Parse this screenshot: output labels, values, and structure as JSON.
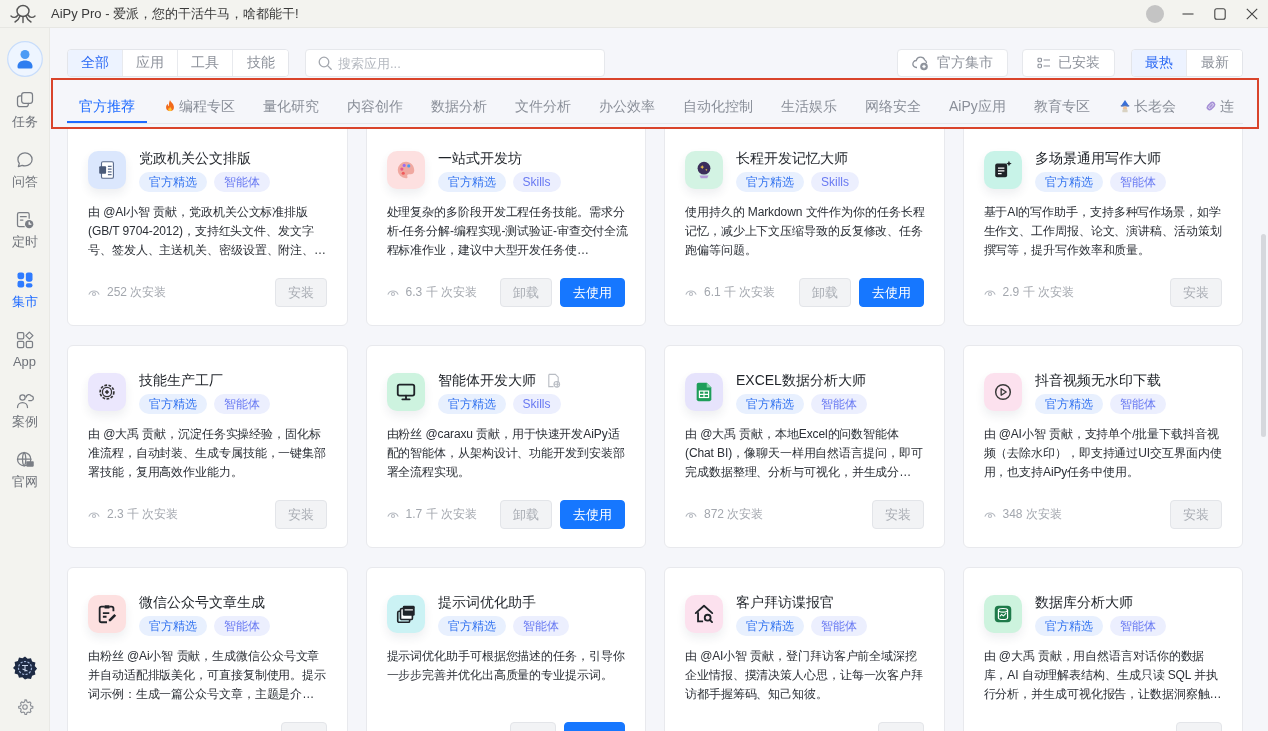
{
  "window": {
    "title": "AiPy Pro - 爱派，您的干活牛马，啥都能干!"
  },
  "sidebar": {
    "items": [
      {
        "label": "任务",
        "selected": false
      },
      {
        "label": "问答",
        "selected": false
      },
      {
        "label": "定时",
        "selected": false
      },
      {
        "label": "集市",
        "selected": true
      },
      {
        "label": "App",
        "selected": false
      },
      {
        "label": "案例",
        "selected": false
      },
      {
        "label": "官网",
        "selected": false
      }
    ]
  },
  "filter_tabs": [
    {
      "label": "全部",
      "selected": true
    },
    {
      "label": "应用",
      "selected": false
    },
    {
      "label": "工具",
      "selected": false
    },
    {
      "label": "技能",
      "selected": false
    }
  ],
  "search": {
    "placeholder": "搜索应用..."
  },
  "toolbar_buttons": [
    {
      "label": "官方集市"
    },
    {
      "label": "已安装"
    }
  ],
  "sort_tabs": [
    {
      "label": "最热",
      "selected": true
    },
    {
      "label": "最新",
      "selected": false
    }
  ],
  "category_tabs": [
    {
      "label": "官方推荐",
      "selected": true
    },
    {
      "label": "编程专区",
      "selected": false
    },
    {
      "label": "量化研究",
      "selected": false
    },
    {
      "label": "内容创作",
      "selected": false
    },
    {
      "label": "数据分析",
      "selected": false
    },
    {
      "label": "文件分析",
      "selected": false
    },
    {
      "label": "办公效率",
      "selected": false
    },
    {
      "label": "自动化控制",
      "selected": false
    },
    {
      "label": "生活娱乐",
      "selected": false
    },
    {
      "label": "网络安全",
      "selected": false
    },
    {
      "label": "AiPy应用",
      "selected": false
    },
    {
      "label": "教育专区",
      "selected": false
    },
    {
      "label": "长老会",
      "selected": false
    },
    {
      "label": "连",
      "selected": false
    }
  ],
  "cards": [
    {
      "title": "党政机关公文排版",
      "color": "#dbe7fd",
      "tags": [
        {
          "label": "官方精选",
          "kind": "featured"
        },
        {
          "label": "智能体",
          "kind": "type"
        }
      ],
      "description": "由 @AI小智 贡献，党政机关公文标准排版(GB/T 9704-2012)，支持红头文件、发文字号、签发人、主送机关、密级设置、附注、…",
      "installs": "252 次安装",
      "actions": [
        {
          "label": "安装",
          "kind": "secondary"
        }
      ]
    },
    {
      "title": "一站式开发坊",
      "color": "#fde0e0",
      "tags": [
        {
          "label": "官方精选",
          "kind": "featured"
        },
        {
          "label": "Skills",
          "kind": "type"
        }
      ],
      "description": "处理复杂的多阶段开发工程任务技能。需求分析-任务分解-编程实现-测试验证-审查交付全流程标准作业，建议中大型开发任务使…",
      "installs": "6.3 千 次安装",
      "actions": [
        {
          "label": "卸载",
          "kind": "secondary"
        },
        {
          "label": "去使用",
          "kind": "primary"
        }
      ]
    },
    {
      "title": "长程开发记忆大师",
      "color": "#d3f3e3",
      "tags": [
        {
          "label": "官方精选",
          "kind": "featured"
        },
        {
          "label": "Skills",
          "kind": "type"
        }
      ],
      "description": "使用持久的 Markdown 文件作为你的任务长程记忆，减少上下文压缩导致的反复修改、任务跑偏等问题。",
      "installs": "6.1 千 次安装",
      "actions": [
        {
          "label": "卸载",
          "kind": "secondary"
        },
        {
          "label": "去使用",
          "kind": "primary"
        }
      ]
    },
    {
      "title": "多场景通用写作大师",
      "color": "#c8f3e8",
      "tags": [
        {
          "label": "官方精选",
          "kind": "featured"
        },
        {
          "label": "智能体",
          "kind": "type"
        }
      ],
      "description": "基于AI的写作助手，支持多种写作场景，如学生作文、工作周报、论文、演讲稿、活动策划撰写等，提升写作效率和质量。",
      "installs": "2.9 千 次安装",
      "actions": [
        {
          "label": "安装",
          "kind": "secondary"
        }
      ]
    },
    {
      "title": "技能生产工厂",
      "color": "#ebe7fd",
      "tags": [
        {
          "label": "官方精选",
          "kind": "featured"
        },
        {
          "label": "智能体",
          "kind": "type"
        }
      ],
      "description": "由 @大禹 贡献，沉淀任务实操经验，固化标准流程，自动封装、生成专属技能，一键集部署技能，复用高效作业能力。",
      "installs": "2.3 千 次安装",
      "actions": [
        {
          "label": "安装",
          "kind": "secondary"
        }
      ]
    },
    {
      "title": "智能体开发大师",
      "color": "#cdf3df",
      "title_badge": true,
      "tags": [
        {
          "label": "官方精选",
          "kind": "featured"
        },
        {
          "label": "Skills",
          "kind": "type"
        }
      ],
      "description": "由粉丝 @caraxu 贡献，用于快速开发AiPy适配的智能体，从架构设计、功能开发到安装部署全流程实现。",
      "installs": "1.7 千 次安装",
      "actions": [
        {
          "label": "卸载",
          "kind": "secondary"
        },
        {
          "label": "去使用",
          "kind": "primary"
        }
      ]
    },
    {
      "title": "EXCEL数据分析大师",
      "color": "#e6e3fc",
      "tags": [
        {
          "label": "官方精选",
          "kind": "featured"
        },
        {
          "label": "智能体",
          "kind": "type"
        }
      ],
      "description": "由 @大禹 贡献，本地Excel的问数智能体(Chat BI)，像聊天一样用自然语言提问，即可完成数据整理、分析与可视化，并生成分…",
      "installs": "872 次安装",
      "actions": [
        {
          "label": "安装",
          "kind": "secondary"
        }
      ]
    },
    {
      "title": "抖音视频无水印下载",
      "color": "#fce1ee",
      "tags": [
        {
          "label": "官方精选",
          "kind": "featured"
        },
        {
          "label": "智能体",
          "kind": "type"
        }
      ],
      "description": "由 @AI小智 贡献，支持单个/批量下载抖音视频（去除水印），即支持通过UI交互界面内使用，也支持AiPy任务中使用。",
      "installs": "348 次安装",
      "actions": [
        {
          "label": "安装",
          "kind": "secondary"
        }
      ]
    },
    {
      "title": "微信公众号文章生成",
      "color": "#fde0e0",
      "tags": [
        {
          "label": "官方精选",
          "kind": "featured"
        },
        {
          "label": "智能体",
          "kind": "type"
        }
      ],
      "description": "由粉丝 @Ai小智 贡献，生成微信公众号文章并自动适配排版美化，可直接复制使用。提示词示例：生成一篇公众号文章，主题是介…",
      "actions": [
        {
          "kind": "secondary"
        }
      ]
    },
    {
      "title": "提示词优化助手",
      "color": "#cbf2f4",
      "tags": [
        {
          "label": "官方精选",
          "kind": "featured"
        },
        {
          "label": "智能体",
          "kind": "type"
        }
      ],
      "description": "提示词优化助手可根据您描述的任务，引导你一步步完善并优化出高质量的专业提示词。",
      "actions": [
        {
          "kind": "secondary"
        },
        {
          "kind": "primary"
        }
      ]
    },
    {
      "title": "客户拜访谍报官",
      "color": "#fce1ee",
      "tags": [
        {
          "label": "官方精选",
          "kind": "featured"
        },
        {
          "label": "智能体",
          "kind": "type"
        }
      ],
      "description": "由 @AI小智 贡献，登门拜访客户前全域深挖企业情报、摸清决策人心思，让每一次客户拜访都手握筹码、知己知彼。",
      "actions": [
        {
          "kind": "secondary"
        }
      ]
    },
    {
      "title": "数据库分析大师",
      "color": "#cdf3de",
      "tags": [
        {
          "label": "官方精选",
          "kind": "featured"
        },
        {
          "label": "智能体",
          "kind": "type"
        }
      ],
      "description": "由 @大禹 贡献，用自然语言对话你的数据库，AI 自动理解表结构、生成只读 SQL 并执行分析，并生成可视化报告，让数据洞察触…",
      "actions": [
        {
          "kind": "secondary"
        }
      ]
    }
  ]
}
